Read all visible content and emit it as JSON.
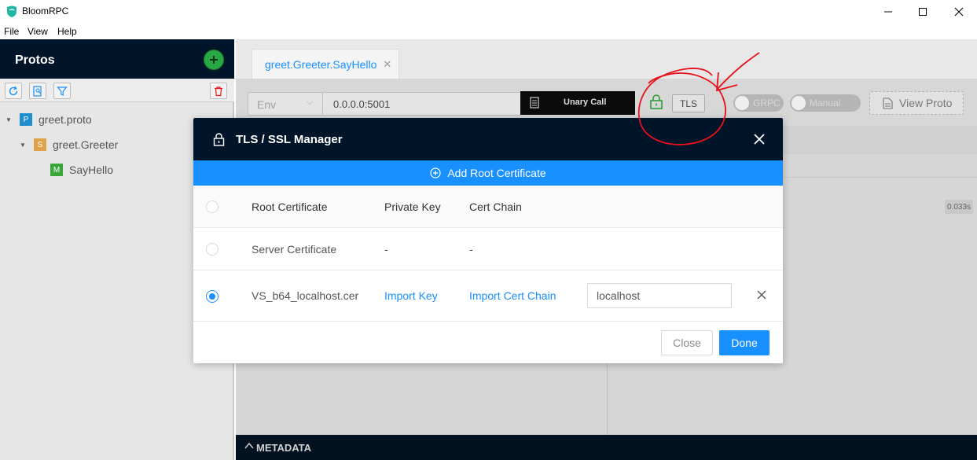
{
  "window": {
    "title": "BloomRPC",
    "icons": [
      "bloomrpc-logo-icon",
      "minimize-icon",
      "maximize-icon",
      "close-icon"
    ]
  },
  "menu": {
    "items": [
      {
        "label": "File"
      },
      {
        "label": "View"
      },
      {
        "label": "Help"
      }
    ]
  },
  "sidebar": {
    "title": "Protos",
    "tools": [
      "reload-icon",
      "file-search-icon",
      "filter-icon",
      "delete-icon"
    ],
    "tree": [
      {
        "badge": "P",
        "label": "greet.proto",
        "color": "#1f8ecf"
      },
      {
        "badge": "S",
        "label": "greet.Greeter",
        "color": "#e0a347"
      },
      {
        "badge": "M",
        "label": "SayHello",
        "color": "#3aa63a"
      }
    ]
  },
  "tabs": [
    {
      "label": "greet.Greeter.SayHello"
    }
  ],
  "toolbar": {
    "env_placeholder": "Env",
    "url": "0.0.0.0:5001",
    "call_label": "Unary Call",
    "tls_label": "TLS",
    "grpc_label": "GRPC",
    "manual_label": "Manual",
    "view_proto_label": "View Proto"
  },
  "response": {
    "time": "0.033s"
  },
  "metadata": {
    "label": "METADATA"
  },
  "modal": {
    "title": "TLS / SSL Manager",
    "add_root_label": "Add Root Certificate",
    "columns": {
      "root": "Root Certificate",
      "key": "Private Key",
      "chain": "Cert Chain"
    },
    "rows": [
      {
        "root": "Server Certificate",
        "key": "-",
        "chain": "-",
        "selected": false
      },
      {
        "root": "VS_b64_localhost.cer",
        "key": "Import Key",
        "chain": "Import Cert Chain",
        "host": "localhost",
        "selected": true
      }
    ],
    "close_label": "Close",
    "done_label": "Done"
  },
  "colors": {
    "accent": "#1890ff",
    "header": "#001529",
    "annotation": "#e8101b",
    "add_button": "#28a745",
    "tls_lock": "#2f9e3a"
  }
}
